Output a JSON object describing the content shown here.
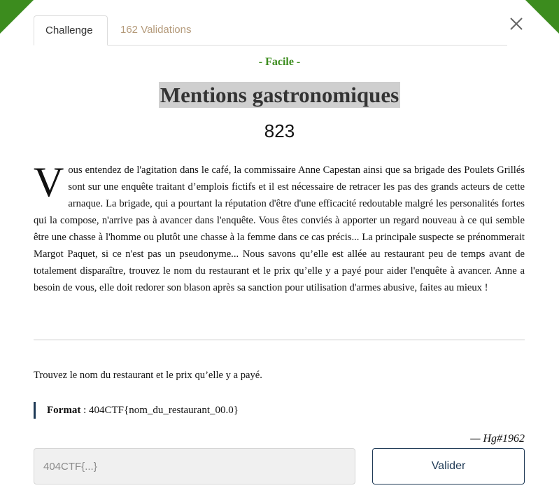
{
  "tabs": [
    {
      "label": "Challenge",
      "active": true
    },
    {
      "label": "162 Validations",
      "active": false
    }
  ],
  "challenge": {
    "difficulty": "- Facile -",
    "title": "Mentions gastronomiques",
    "points": "823",
    "description_dropcap": "V",
    "description_rest": "ous entendez de l'agitation dans le café, la commissaire Anne Capestan ainsi que sa brigade des Poulets Grillés sont sur une enquête traitant d’emplois fictifs et il est nécessaire de retracer les pas des grands acteurs de cette arnaque. La brigade, qui a pourtant la réputation d'être d'une efficacité redoutable malgré les personalités fortes qui la compose, n'arrive pas à avancer dans l'enquête. Vous êtes conviés à apporter un regard nouveau à ce qui semble être une chasse à l'homme ou plutôt une chasse à la femme dans ce cas précis... La principale suspecte se prénommerait Margot Paquet, si ce n'est pas un pseudonyme... Nous savons qu’elle est allée au restaurant peu de temps avant de totalement disparaître, trouvez le nom du restaurant et le prix qu’elle y a payé pour aider l'enquête à avancer. Anne a besoin de vous, elle doit redorer son blason après sa sanction pour utilisation d'armes abusive, faites au mieux !",
    "task": "Trouvez le nom du restaurant et le prix qu’elle y a payé.",
    "format_label": "Format",
    "format_value": " : 404CTF{nom_du_restaurant_00.0}",
    "author": "— Hg#1962"
  },
  "form": {
    "flag_placeholder": "404CTF{...}",
    "submit_label": "Valider"
  },
  "icons": {
    "close": "close-icon"
  },
  "colors": {
    "accent_green": "#3c8c1e",
    "navy": "#1f3a56",
    "tab_inactive": "#b49a7a"
  }
}
